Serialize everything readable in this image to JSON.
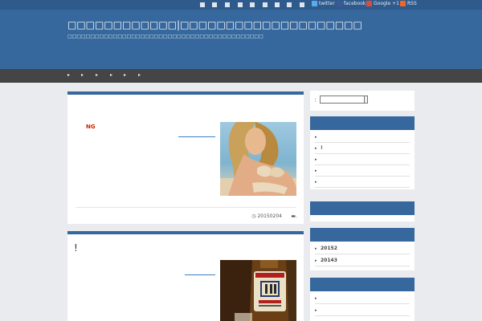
{
  "topbar": {
    "icons": [
      "rss-square-icon",
      "link-icon",
      "bookmark-icon",
      "star-icon",
      "heart-icon",
      "share-icon",
      "tag-icon",
      "plus-icon",
      "user-icon",
      "grid-icon",
      "mail-icon"
    ],
    "social": [
      {
        "label": "twitter",
        "icon": "twitter-icon",
        "color": "#55acee"
      },
      {
        "label": "facebook",
        "icon": "facebook-icon",
        "color": "#3b5998"
      },
      {
        "label": "Google +1",
        "icon": "google-plus-icon",
        "color": "#dd4b39"
      },
      {
        "label": "RSS",
        "icon": "rss-icon",
        "color": "#f26522"
      }
    ]
  },
  "header": {
    "title": "□□□□□□□□□□□□|□□□□□□□□□□□□□□□□□□□□",
    "description": "□□□□□□□□□□□□□□□□□□□□□□□□□□□□□□□□□□□□□□□□□□□"
  },
  "nav": {
    "items": [
      "▸",
      "▸",
      "▸",
      "▸",
      "▸",
      "▸"
    ]
  },
  "posts": [
    {
      "label": "NG",
      "date": "20150204",
      "image": "woman-bikini-beach-photo"
    },
    {
      "title": "!",
      "image": "bottle-and-glass-photo"
    }
  ],
  "sidebar": {
    "search_label": "：",
    "search_value": "",
    "widget1_items": [
      "",
      "!",
      "",
      "",
      ""
    ],
    "archives": [
      "20152",
      "20143"
    ],
    "widget4_items": [
      "",
      ""
    ]
  },
  "colors": {
    "header_bg": "#36689d",
    "topbar_bg": "#2e5a8c",
    "nav_bg": "#454545",
    "accent": "#36689d",
    "ng_label": "#cc2200"
  }
}
